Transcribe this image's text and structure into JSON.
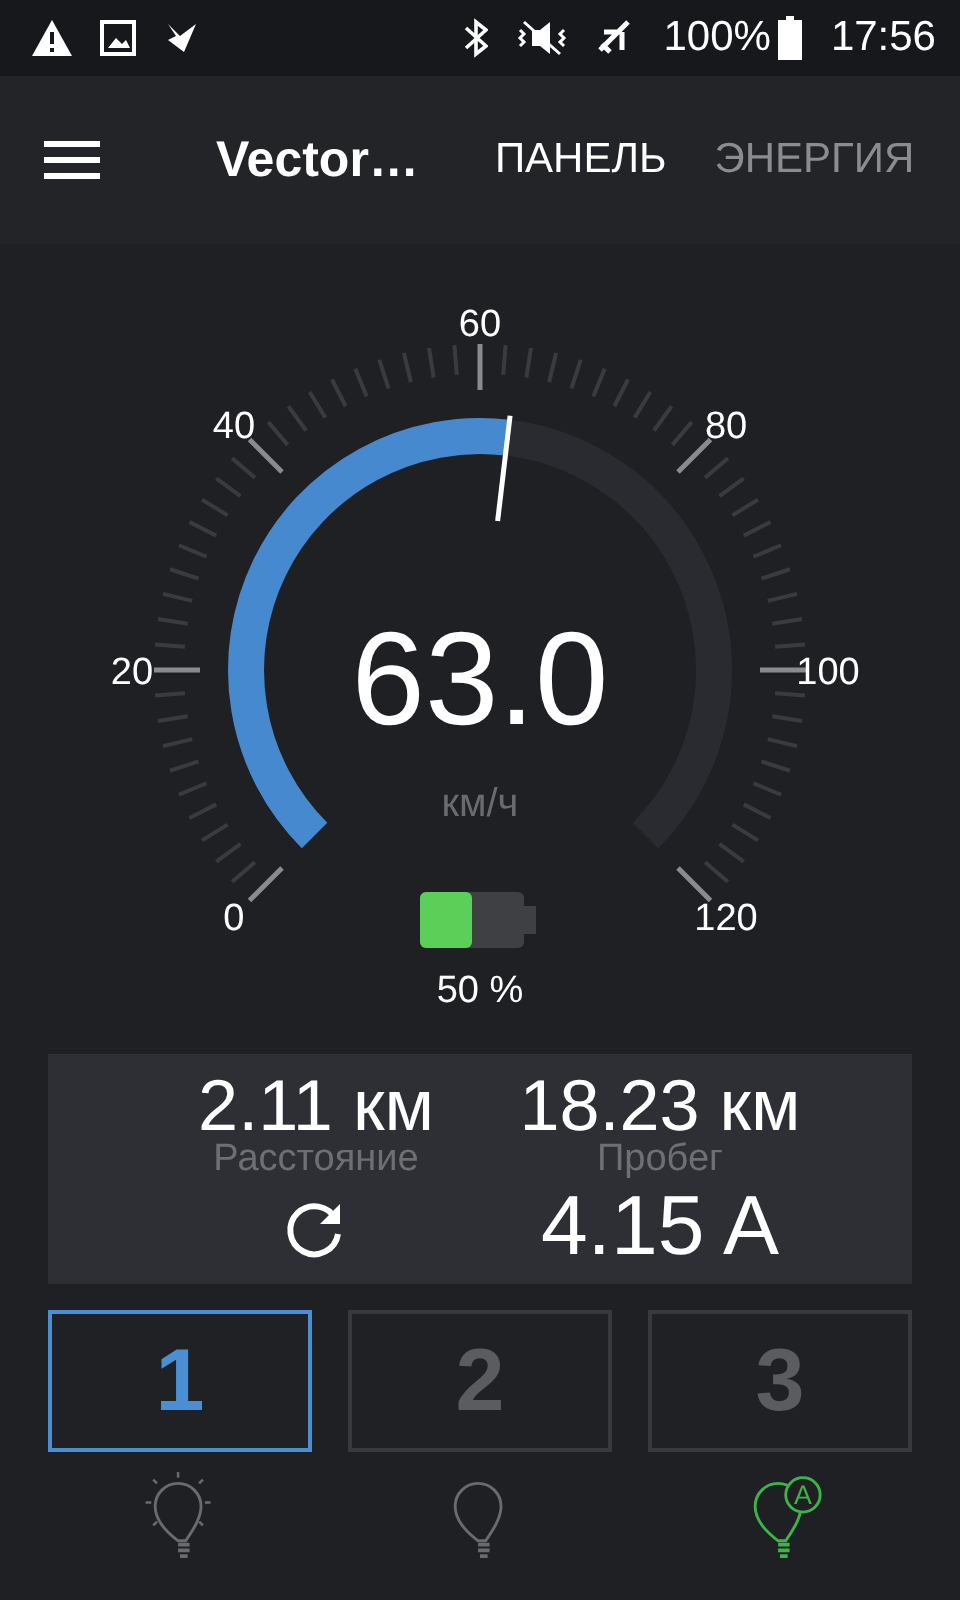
{
  "status_bar": {
    "battery": "100%",
    "time": "17:56"
  },
  "app_bar": {
    "title": "Vector…",
    "tabs": [
      {
        "label": "ПАНЕЛЬ",
        "selected": true
      },
      {
        "label": "ЭНЕРГИЯ",
        "selected": false
      }
    ]
  },
  "gauge": {
    "value": "63.0",
    "unit": "км/ч",
    "scale_labels": [
      "0",
      "20",
      "40",
      "60",
      "80",
      "100",
      "120"
    ]
  },
  "battery": {
    "reading": "50 %"
  },
  "stats": {
    "distance": {
      "value": "2.11 км",
      "label": "Расстояние"
    },
    "mileage": {
      "value": "18.23 км",
      "label": "Пробег"
    },
    "current": "4.15 A"
  },
  "modes": [
    {
      "label": "1",
      "selected": true
    },
    {
      "label": "2",
      "selected": false
    },
    {
      "label": "3",
      "selected": false
    }
  ],
  "lights": [
    {
      "kind": "on"
    },
    {
      "kind": "off"
    },
    {
      "kind": "auto",
      "badge": "A"
    }
  ]
}
